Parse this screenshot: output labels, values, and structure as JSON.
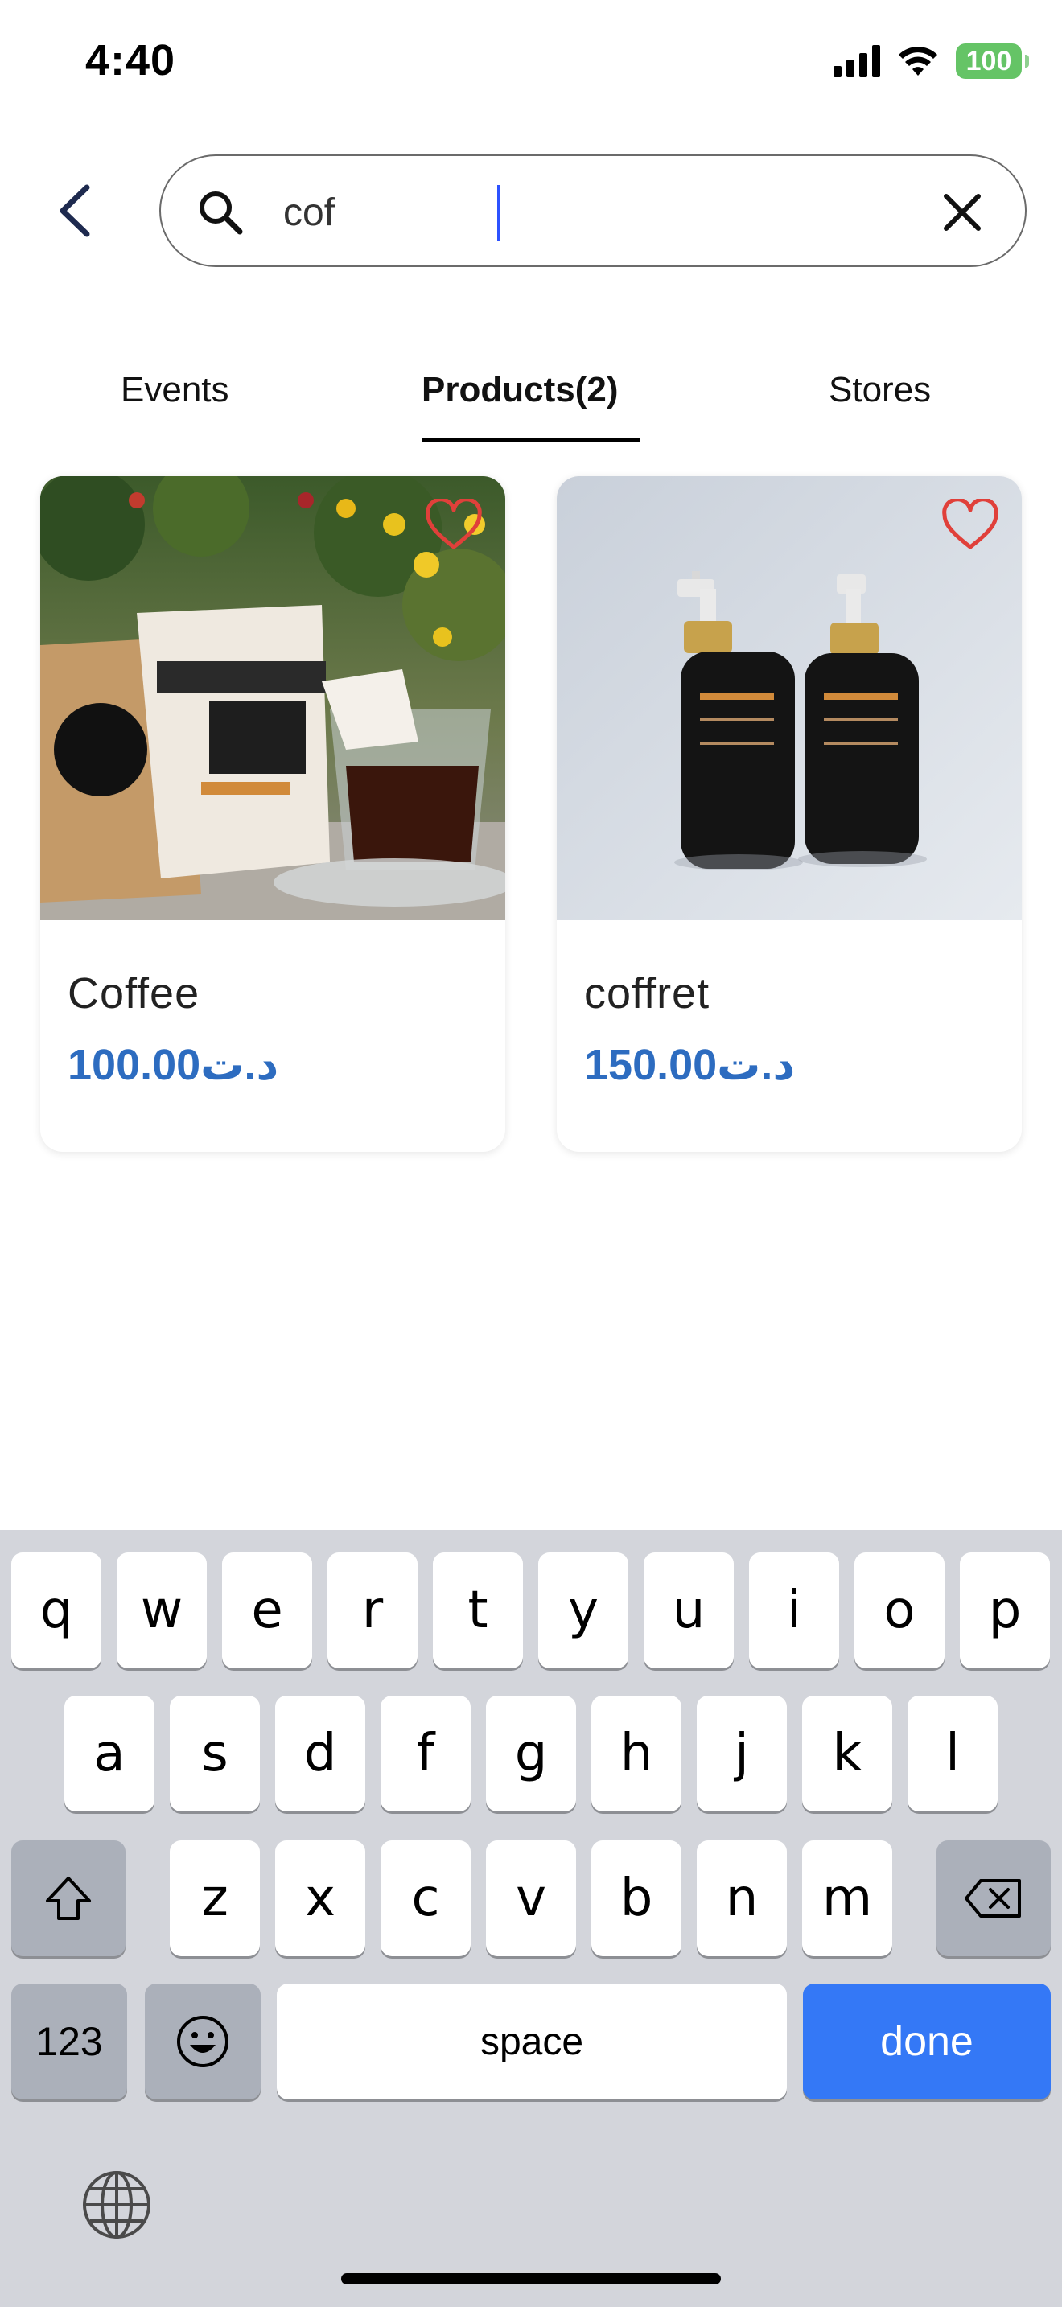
{
  "status_bar": {
    "time": "4:40",
    "battery": "100"
  },
  "search": {
    "value": "cof"
  },
  "tabs": [
    {
      "label": "Events",
      "active": false
    },
    {
      "label": "Products(2)",
      "active": true
    },
    {
      "label": "Stores",
      "active": false
    }
  ],
  "products": [
    {
      "name": "Coffee",
      "price": "100.00د.ت",
      "favorite_icon": "heart-outline-icon"
    },
    {
      "name": "coffret",
      "price": "150.00د.ت",
      "favorite_icon": "heart-outline-icon"
    }
  ],
  "keyboard": {
    "row1": [
      "q",
      "w",
      "e",
      "r",
      "t",
      "y",
      "u",
      "i",
      "o",
      "p"
    ],
    "row2": [
      "a",
      "s",
      "d",
      "f",
      "g",
      "h",
      "j",
      "k",
      "l"
    ],
    "row3": [
      "z",
      "x",
      "c",
      "v",
      "b",
      "n",
      "m"
    ],
    "numbers_label": "123",
    "space_label": "space",
    "done_label": "done"
  },
  "colors": {
    "accent": "#3478f6",
    "price": "#2d6cc0",
    "heart": "#e0403a",
    "battery": "#65c466"
  }
}
